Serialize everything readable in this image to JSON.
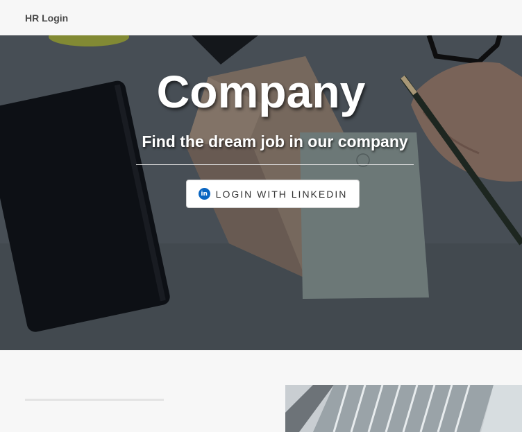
{
  "navbar": {
    "brand": "HR Login"
  },
  "hero": {
    "title": "Company",
    "subtitle": "Find the dream job in our company",
    "login_button": {
      "icon": "linkedin-icon",
      "icon_text": "in",
      "label": "LOGIN WITH LINKEDIN"
    }
  },
  "colors": {
    "linkedin": "#0a66c2",
    "navbar_bg": "#f7f7f7"
  }
}
